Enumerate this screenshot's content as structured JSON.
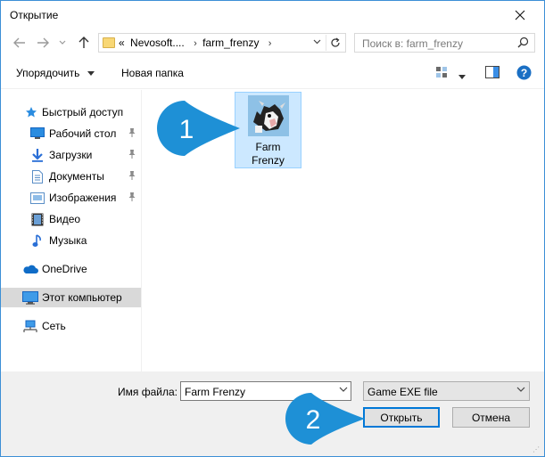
{
  "window": {
    "title": "Открытие"
  },
  "address": {
    "crumbs": [
      "Nevosoft....",
      "farm_frenzy"
    ],
    "prefix": "«"
  },
  "search": {
    "placeholder": "Поиск в: farm_frenzy"
  },
  "toolbar": {
    "organize": "Упорядочить",
    "new_folder": "Новая папка"
  },
  "sidebar": {
    "items": [
      {
        "label": "Быстрый доступ",
        "icon": "star-icon"
      },
      {
        "label": "Рабочий стол",
        "icon": "desktop-icon",
        "pinned": true
      },
      {
        "label": "Загрузки",
        "icon": "download-icon",
        "pinned": true
      },
      {
        "label": "Документы",
        "icon": "document-icon",
        "pinned": true
      },
      {
        "label": "Изображения",
        "icon": "pictures-icon",
        "pinned": true
      },
      {
        "label": "Видео",
        "icon": "video-icon"
      },
      {
        "label": "Музыка",
        "icon": "music-icon"
      },
      {
        "label": "OneDrive",
        "icon": "cloud-icon"
      },
      {
        "label": "Этот компьютер",
        "icon": "computer-icon",
        "selected": true
      },
      {
        "label": "Сеть",
        "icon": "network-icon"
      }
    ]
  },
  "files": [
    {
      "name": "Farm Frenzy",
      "line1": "Farm",
      "line2": "Frenzy"
    }
  ],
  "callouts": {
    "first": "1",
    "second": "2"
  },
  "footer": {
    "filename_label": "Имя файла:",
    "filename_value": "Farm Frenzy",
    "filetype": "Game EXE file",
    "open": "Открыть",
    "cancel": "Отмена"
  },
  "colors": {
    "accent": "#0078d7",
    "callout": "#1e90d6",
    "selection": "#cce8ff"
  }
}
